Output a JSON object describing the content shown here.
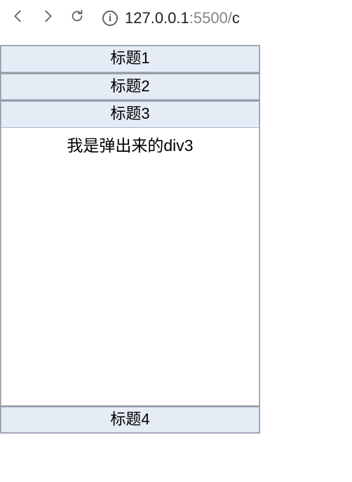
{
  "toolbar": {
    "url_host": "127.0.0.1",
    "url_port": ":5500/",
    "url_tail": "c"
  },
  "accordion": {
    "items": [
      {
        "title": "标题1"
      },
      {
        "title": "标题2"
      },
      {
        "title": "标题3",
        "content": "我是弹出来的div3"
      },
      {
        "title": "标题4"
      }
    ]
  }
}
